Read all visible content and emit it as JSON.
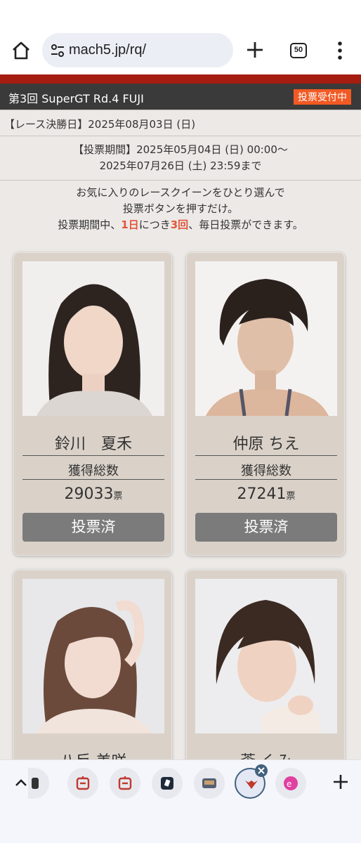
{
  "browser": {
    "url": "mach5.jp/rq/",
    "tab_count": "50"
  },
  "event": {
    "title": "第3回 SuperGT Rd.4 FUJI",
    "status_badge": "投票受付中",
    "final_date": "【レース決勝日】2025年08月03日 (日)",
    "period_line1": "【投票期間】2025年05月04日 (日) 00:00～",
    "period_line2": "2025年07月26日 (土) 23:59まで",
    "intro_line1": "お気に入りのレースクイーンをひとり選んで",
    "intro_line2": "投票ボタンを押すだけ。",
    "intro_line3_a": "投票期間中、",
    "intro_line3_b": "1日",
    "intro_line3_c": "につき",
    "intro_line3_d": "3回",
    "intro_line3_e": "、毎日投票ができます。"
  },
  "cards": [
    {
      "name": "鈴川　夏禾",
      "label": "獲得総数",
      "count": "29033",
      "unit": "票",
      "button": "投票済"
    },
    {
      "name": "仲原 ちえ",
      "label": "獲得総数",
      "count": "27241",
      "unit": "票",
      "button": "投票済"
    },
    {
      "name": "八反 美咲",
      "label": "",
      "count": "",
      "unit": "",
      "button": ""
    },
    {
      "name": "蒼 くみ",
      "label": "",
      "count": "",
      "unit": "",
      "button": ""
    }
  ],
  "colors": {
    "accent_red": "#a51c10",
    "badge_orange": "#f15a24",
    "card_bg": "#dad2c9",
    "button_gray": "#7b7b7b"
  },
  "icons": [
    "home-icon",
    "site-settings-icon",
    "new-tab-icon",
    "tab-switcher-icon",
    "more-menu-icon",
    "collapse-chevron-icon",
    "close-icon",
    "add-tab-icon"
  ]
}
